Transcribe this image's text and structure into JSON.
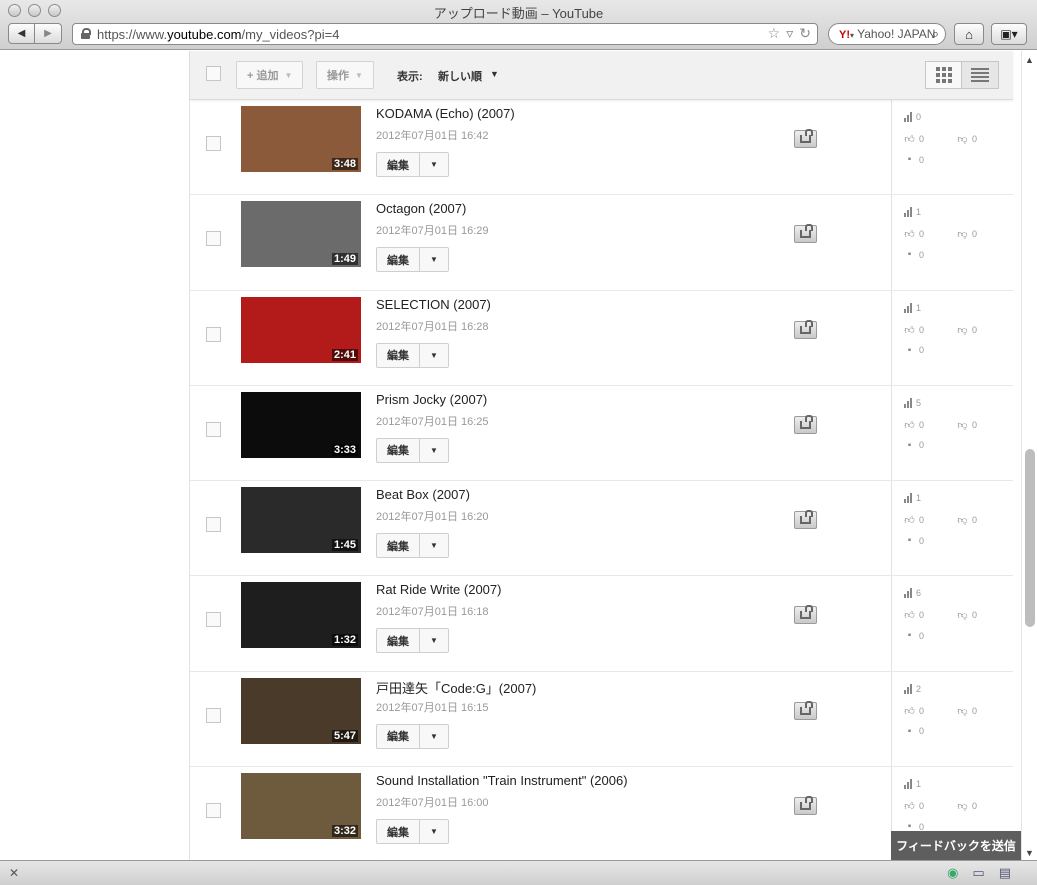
{
  "window": {
    "title": "アップロード動画 – YouTube",
    "url_prefix": "https://www.",
    "url_domain": "youtube.com",
    "url_path": "/my_videos?pi=4",
    "search_placeholder": "Yahoo! JAPAN",
    "search_engine": "Y!"
  },
  "action_bar": {
    "add_label": "+ 追加",
    "actions_label": "操作",
    "sort_label": "表示:",
    "sort_value": "新しい順"
  },
  "row_labels": {
    "edit": "編集"
  },
  "videos": [
    {
      "title": "KODAMA (Echo) (2007)",
      "date": "2012年07月01日 16:42",
      "duration": "3:48",
      "views": "0",
      "likes": "0",
      "dislikes": "0",
      "comments": "0",
      "thumb_bg": "#8a5a3a"
    },
    {
      "title": "Octagon (2007)",
      "date": "2012年07月01日 16:29",
      "duration": "1:49",
      "views": "1",
      "likes": "0",
      "dislikes": "0",
      "comments": "0",
      "thumb_bg": "#6b6b6b"
    },
    {
      "title": "SELECTION (2007)",
      "date": "2012年07月01日 16:28",
      "duration": "2:41",
      "views": "1",
      "likes": "0",
      "dislikes": "0",
      "comments": "0",
      "thumb_bg": "#b31a1a"
    },
    {
      "title": "Prism Jocky (2007)",
      "date": "2012年07月01日 16:25",
      "duration": "3:33",
      "views": "5",
      "likes": "0",
      "dislikes": "0",
      "comments": "0",
      "thumb_bg": "#0c0c0c"
    },
    {
      "title": "Beat Box (2007)",
      "date": "2012年07月01日 16:20",
      "duration": "1:45",
      "views": "1",
      "likes": "0",
      "dislikes": "0",
      "comments": "0",
      "thumb_bg": "#2a2a2a"
    },
    {
      "title": "Rat Ride Write (2007)",
      "date": "2012年07月01日 16:18",
      "duration": "1:32",
      "views": "6",
      "likes": "0",
      "dislikes": "0",
      "comments": "0",
      "thumb_bg": "#1e1e1e"
    },
    {
      "title": "戸田達矢「Code:G」(2007)",
      "date": "2012年07月01日 16:15",
      "duration": "5:47",
      "views": "2",
      "likes": "0",
      "dislikes": "0",
      "comments": "0",
      "thumb_bg": "#4a3a2a"
    },
    {
      "title": "Sound Installation \"Train Instrument\" (2006)",
      "date": "2012年07月01日 16:00",
      "duration": "3:32",
      "views": "1",
      "likes": "0",
      "dislikes": "0",
      "comments": "0",
      "thumb_bg": "#6e5a3c"
    }
  ],
  "feedback_label": "フィードバックを送信"
}
